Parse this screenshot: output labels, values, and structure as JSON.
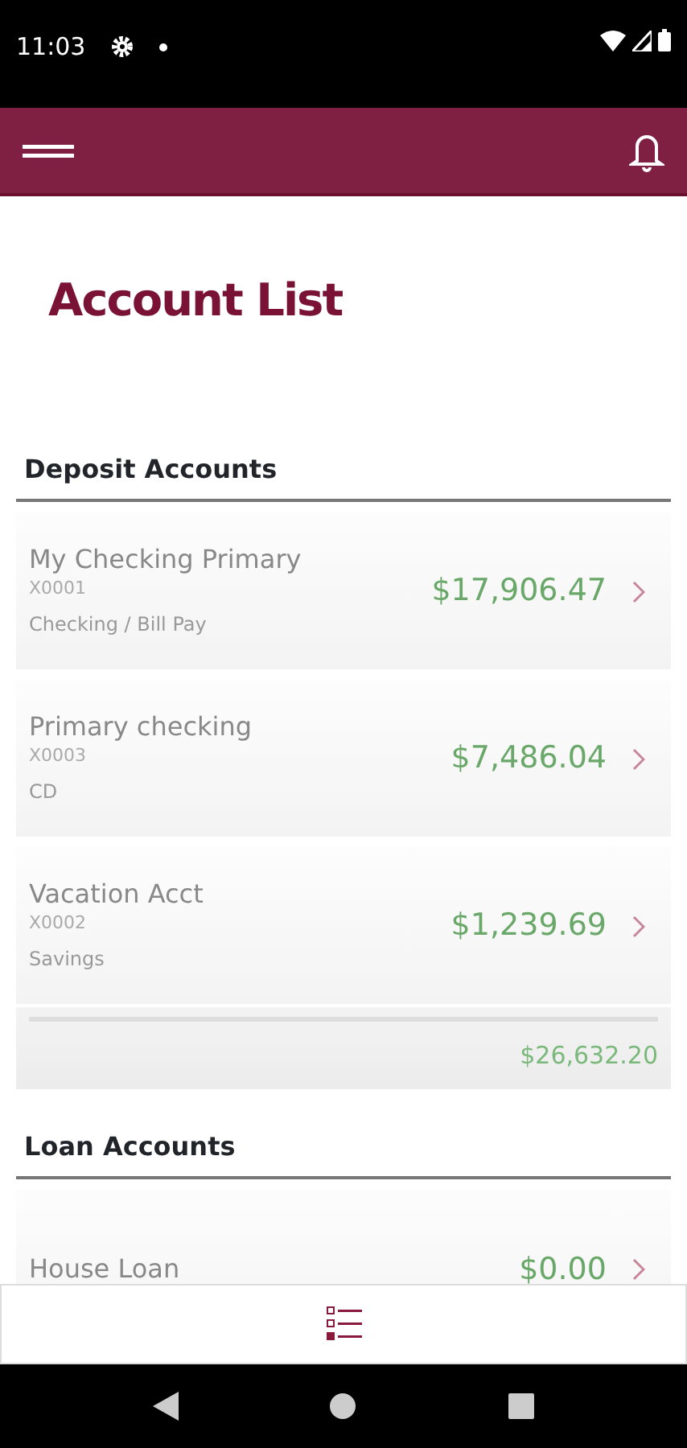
{
  "status_bar": {
    "time": "11:03"
  },
  "title": "Account List",
  "sections": [
    {
      "heading": "Deposit Accounts",
      "accounts": [
        {
          "name": "My Checking Primary",
          "number": "X0001",
          "type": "Checking / Bill Pay",
          "balance": "$17,906.47"
        },
        {
          "name": "Primary checking",
          "number": "X0003",
          "type": "CD",
          "balance": "$7,486.04"
        },
        {
          "name": "Vacation Acct",
          "number": "X0002",
          "type": "Savings",
          "balance": "$1,239.69"
        }
      ],
      "total": "$26,632.20"
    },
    {
      "heading": "Loan Accounts",
      "accounts": [
        {
          "name": "House Loan",
          "balance": "$0.00"
        }
      ]
    }
  ],
  "bottom_tabs": [
    {
      "kind": "list",
      "selected": true
    }
  ]
}
